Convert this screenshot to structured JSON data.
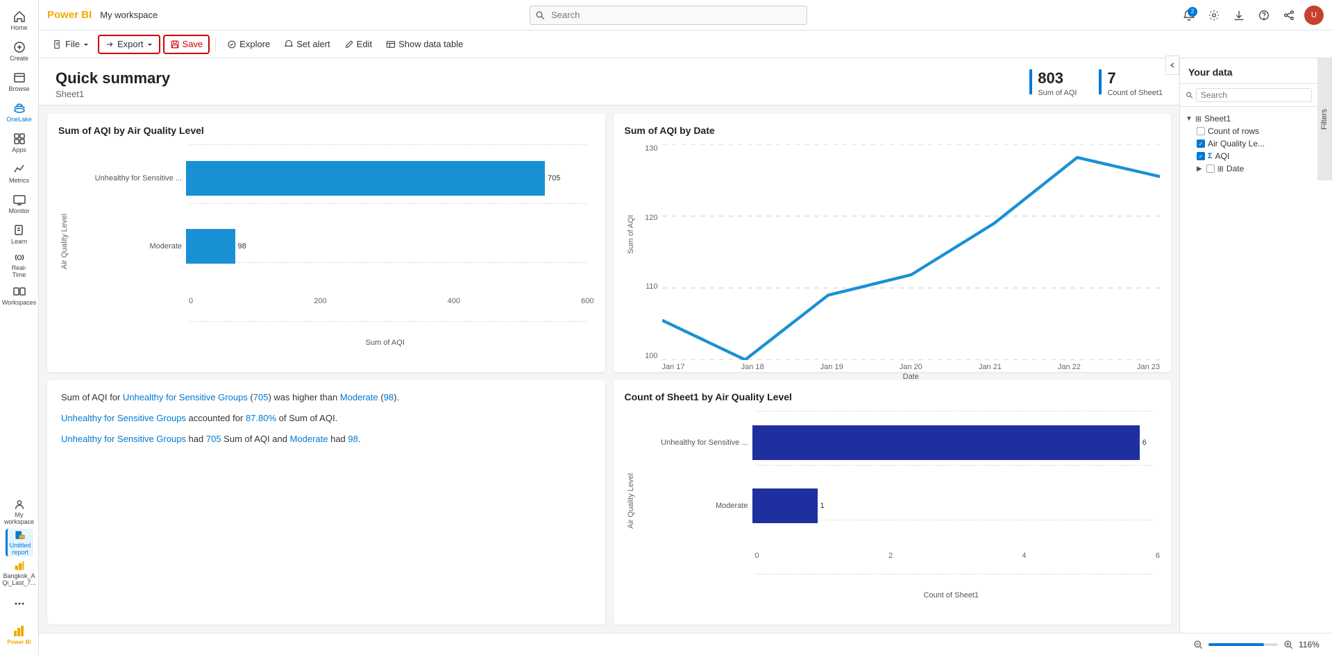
{
  "app": {
    "brand": "Power BI",
    "workspace": "My workspace"
  },
  "topbar": {
    "search_placeholder": "Search",
    "notification_badge": "2"
  },
  "toolbar": {
    "file_label": "File",
    "export_label": "Export",
    "save_label": "Save",
    "explore_label": "Explore",
    "set_alert_label": "Set alert",
    "edit_label": "Edit",
    "show_data_table_label": "Show data table"
  },
  "report": {
    "title": "Quick summary",
    "subtitle": "Sheet1",
    "kpi1_value": "803",
    "kpi1_label": "Sum of AQI",
    "kpi2_value": "7",
    "kpi2_label": "Count of Sheet1"
  },
  "chart1": {
    "title": "Sum of AQI by Air Quality Level",
    "y_axis_label": "Air Quality Level",
    "x_axis_label": "Sum of AQI",
    "bars": [
      {
        "label": "Unhealthy for Sensitive ...",
        "value": 705,
        "max": 800,
        "color": "#1a90d4"
      },
      {
        "label": "Moderate",
        "value": 98,
        "max": 800,
        "color": "#1a90d4"
      }
    ],
    "x_ticks": [
      "0",
      "200",
      "400",
      "600"
    ]
  },
  "chart2": {
    "title": "Sum of AQI by Date",
    "y_axis_label": "Sum of AQI",
    "x_axis_label": "Date",
    "x_labels": [
      "Jan 17",
      "Jan 18",
      "Jan 19",
      "Jan 20",
      "Jan 21",
      "Jan 22",
      "Jan 23"
    ],
    "y_ticks": [
      "100",
      "110",
      "120",
      "130"
    ],
    "points": [
      {
        "x": 0,
        "y": 103
      },
      {
        "x": 1,
        "y": 97
      },
      {
        "x": 2,
        "y": 107
      },
      {
        "x": 3,
        "y": 110
      },
      {
        "x": 4,
        "y": 118
      },
      {
        "x": 5,
        "y": 128
      },
      {
        "x": 6,
        "y": 125
      }
    ]
  },
  "chart3": {
    "title": "Count of Sheet1 by Air Quality Level",
    "y_axis_label": "Air Quality Level",
    "x_axis_label": "Count of Sheet1",
    "bars": [
      {
        "label": "Unhealthy for Sensitive ...",
        "value": 6,
        "max": 6,
        "color": "#1e2fa0"
      },
      {
        "label": "Moderate",
        "value": 1,
        "max": 6,
        "color": "#1e2fa0"
      }
    ],
    "x_ticks": [
      "0",
      "2",
      "4",
      "6"
    ]
  },
  "summary": {
    "line1": "Sum of AQI for Unhealthy for Sensitive Groups (705) was higher than Moderate (98).",
    "line1_highlight1": "Unhealthy for Sensitive Groups",
    "line1_highlight2": "705",
    "line1_highlight3": "Moderate",
    "line1_highlight4": "98",
    "line2": "Unhealthy for Sensitive Groups accounted for 87.80% of Sum of AQI.",
    "line2_highlight1": "Unhealthy for Sensitive Groups",
    "line2_highlight2": "87.80%",
    "line3": "Unhealthy for Sensitive Groups had 705 Sum of AQI and Moderate had 98.",
    "line3_highlight1": "Unhealthy for Sensitive Groups",
    "line3_highlight2": "705",
    "line3_highlight3": "Moderate",
    "line3_highlight4": "98"
  },
  "right_panel": {
    "title": "Your data",
    "search_placeholder": "Search",
    "filters_label": "Filters",
    "tree": {
      "root_label": "Sheet1",
      "items": [
        {
          "label": "Count of rows",
          "type": "checkbox",
          "checked": false,
          "indent": 1
        },
        {
          "label": "Air Quality Le...",
          "type": "checkbox",
          "checked": true,
          "indent": 1
        },
        {
          "label": "AQI",
          "type": "checkbox_sigma",
          "checked": true,
          "indent": 1
        },
        {
          "label": "Date",
          "type": "expand",
          "checked": false,
          "indent": 1
        }
      ]
    }
  },
  "sidebar": {
    "items": [
      {
        "label": "Home",
        "icon": "home"
      },
      {
        "label": "Create",
        "icon": "plus"
      },
      {
        "label": "Browse",
        "icon": "browse"
      },
      {
        "label": "OneLake",
        "icon": "onelake"
      },
      {
        "label": "Apps",
        "icon": "apps"
      },
      {
        "label": "Metrics",
        "icon": "metrics"
      },
      {
        "label": "Monitor",
        "icon": "monitor"
      },
      {
        "label": "Learn",
        "icon": "learn"
      },
      {
        "label": "Real-Time",
        "icon": "realtime"
      },
      {
        "label": "Workspaces",
        "icon": "workspaces"
      },
      {
        "label": "My workspace",
        "icon": "myworkspace"
      },
      {
        "label": "Untitled report",
        "icon": "report",
        "active": true
      },
      {
        "label": "Bangkok_A Qi_Last_7...",
        "icon": "dataset"
      }
    ]
  },
  "bottom_bar": {
    "zoom_label": "116%"
  }
}
